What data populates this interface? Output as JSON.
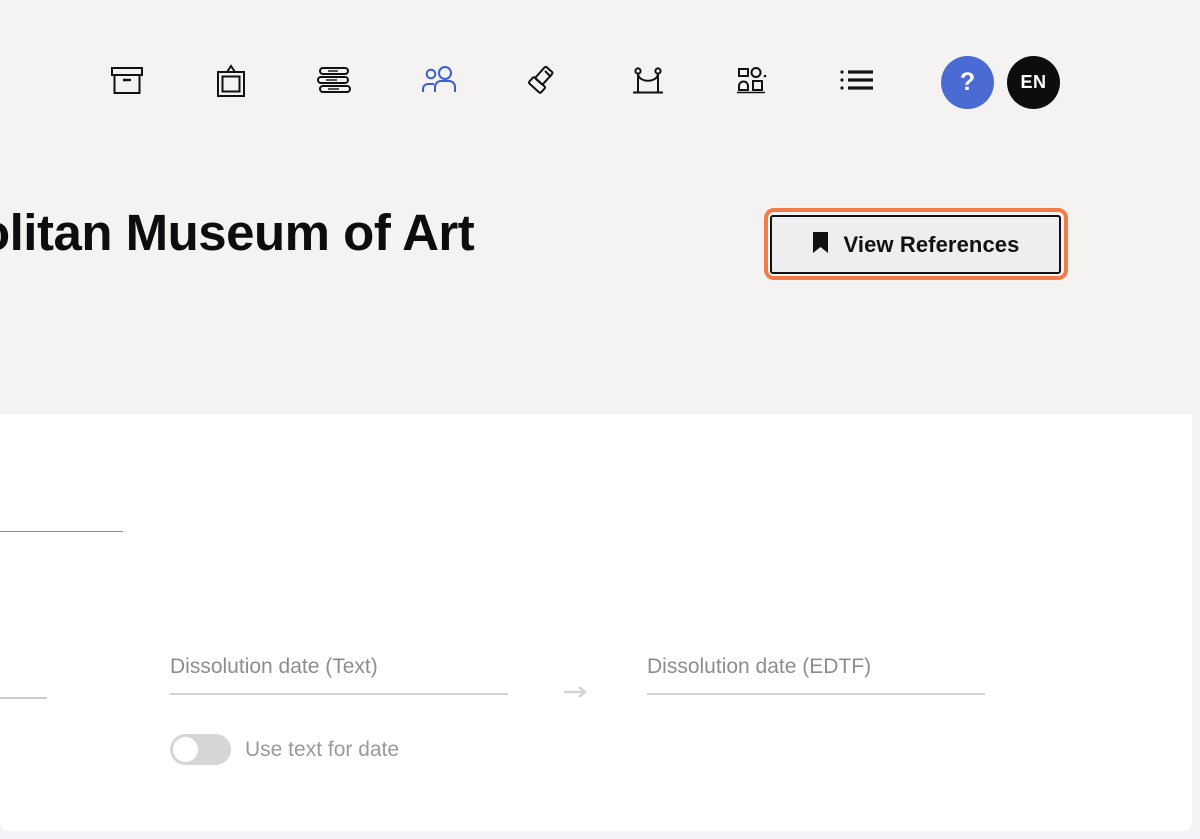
{
  "window": {
    "background_color": "#ffffff",
    "outer_background_color": "#f4f4f8",
    "header_background_color": "#f4f3f1"
  },
  "nav": {
    "items": [
      {
        "name": "archive-box-icon",
        "icon": "archive-box-icon",
        "label": "Archive",
        "active": false
      },
      {
        "name": "framed-artwork-icon",
        "icon": "framed-artwork-icon",
        "label": "Objects",
        "active": false
      },
      {
        "name": "books-stack-icon",
        "icon": "books-stack-icon",
        "label": "Library",
        "active": false
      },
      {
        "name": "people-icon",
        "icon": "people-icon",
        "label": "People",
        "active": true
      },
      {
        "name": "gavel-icon",
        "icon": "gavel-icon",
        "label": "Auctions",
        "active": false
      },
      {
        "name": "stanchion-rope-icon",
        "icon": "stanchion-rope-icon",
        "label": "Exhibitions",
        "active": false
      },
      {
        "name": "gallery-layout-icon",
        "icon": "gallery-layout-icon",
        "label": "Layouts",
        "active": false
      },
      {
        "name": "bulleted-list-icon",
        "icon": "bulleted-list-icon",
        "label": "Lists",
        "active": false
      }
    ],
    "active_color": "#3b5fd9",
    "inactive_color": "#111111",
    "help_button": {
      "label": "?",
      "color": "#4a6ad4"
    },
    "language_button": {
      "label": "EN",
      "color": "#0d0d0d"
    }
  },
  "header": {
    "title": "Metropolitan Museum of Art",
    "title_clipped_visible": "of Art"
  },
  "actions": {
    "view_references": {
      "label": "View References",
      "icon": "bookmark-icon",
      "highlighted": true,
      "highlight_color": "#f47a4a",
      "background_color": "#eeeef0",
      "border_color": "#111111"
    }
  },
  "form": {
    "fields": [
      {
        "name": "dissolution-date-text",
        "label": "Dissolution date (Text)",
        "value": "",
        "placeholder": "Dissolution date (Text)"
      },
      {
        "name": "dissolution-date-edtf",
        "label": "Dissolution date (EDTF)",
        "value": "",
        "placeholder": "Dissolution date (EDTF)"
      }
    ],
    "transfer_arrow_icon": "arrow-right-icon",
    "toggle": {
      "label": "Use text for date",
      "state": "off",
      "track_color": "#d6d6d6",
      "knob_color": "#ffffff"
    }
  },
  "scrollbar": {
    "orientation": "vertical",
    "thumb_color": "#9b9a98"
  }
}
